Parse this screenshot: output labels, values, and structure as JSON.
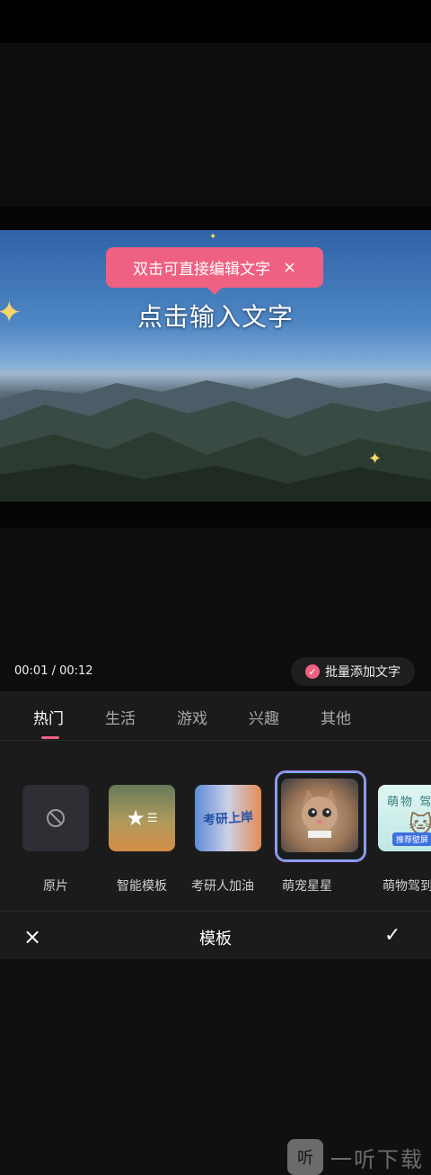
{
  "preview": {
    "tooltip": "双击可直接编辑文字",
    "tooltip_close": "×",
    "overlay_text": "点击输入文字",
    "time_display": "00:01 / 00:12",
    "batch_add_label": "批量添加文字"
  },
  "tabs": [
    {
      "label": "热门",
      "active": true
    },
    {
      "label": "生活"
    },
    {
      "label": "游戏"
    },
    {
      "label": "兴趣"
    },
    {
      "label": "其他"
    }
  ],
  "templates": [
    {
      "label": "原片",
      "icon": "no-symbol-icon"
    },
    {
      "label": "智能模板",
      "icon": "smart-star-icon"
    },
    {
      "label": "考研人加油",
      "thumb_text": "考研上岸"
    },
    {
      "label": "萌宠星星",
      "selected": true
    },
    {
      "label": "萌物驾到",
      "thumb_title": "萌物 驾",
      "thumb_button": "推荐壁屏"
    }
  ],
  "bottom_bar": {
    "close_icon": "×",
    "title": "模板",
    "confirm_icon": "✓"
  },
  "watermark": {
    "logo": "听",
    "text": "一听下载"
  },
  "colors": {
    "accent": "#ee6182",
    "panel_bg": "#1b1b1b",
    "selected_ring": "#9e8ff2"
  }
}
